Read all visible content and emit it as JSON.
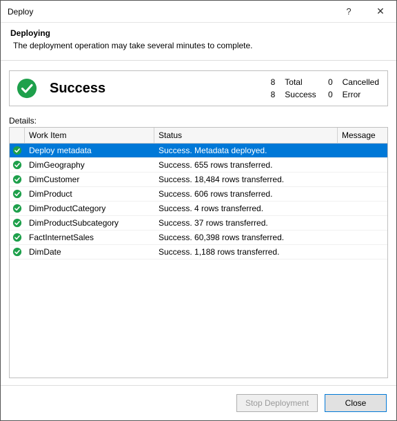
{
  "window": {
    "title": "Deploy"
  },
  "header": {
    "title": "Deploying",
    "subtitle": "The deployment operation may take several minutes to complete."
  },
  "summary": {
    "label": "Success",
    "total_n": "8",
    "total_l": "Total",
    "cancelled_n": "0",
    "cancelled_l": "Cancelled",
    "success_n": "8",
    "success_l": "Success",
    "error_n": "0",
    "error_l": "Error"
  },
  "details": {
    "label": "Details:",
    "columns": {
      "work": "Work Item",
      "status": "Status",
      "message": "Message"
    },
    "rows": [
      {
        "work": "Deploy metadata",
        "status": "Success. Metadata deployed.",
        "message": "",
        "selected": true
      },
      {
        "work": "DimGeography",
        "status": "Success. 655 rows transferred.",
        "message": "",
        "selected": false
      },
      {
        "work": "DimCustomer",
        "status": "Success. 18,484 rows transferred.",
        "message": "",
        "selected": false
      },
      {
        "work": "DimProduct",
        "status": "Success. 606 rows transferred.",
        "message": "",
        "selected": false
      },
      {
        "work": "DimProductCategory",
        "status": "Success. 4 rows transferred.",
        "message": "",
        "selected": false
      },
      {
        "work": "DimProductSubcategory",
        "status": "Success. 37 rows transferred.",
        "message": "",
        "selected": false
      },
      {
        "work": "FactInternetSales",
        "status": "Success. 60,398 rows transferred.",
        "message": "",
        "selected": false
      },
      {
        "work": "DimDate",
        "status": "Success. 1,188 rows transferred.",
        "message": "",
        "selected": false
      }
    ]
  },
  "footer": {
    "stop": "Stop Deployment",
    "close": "Close"
  }
}
